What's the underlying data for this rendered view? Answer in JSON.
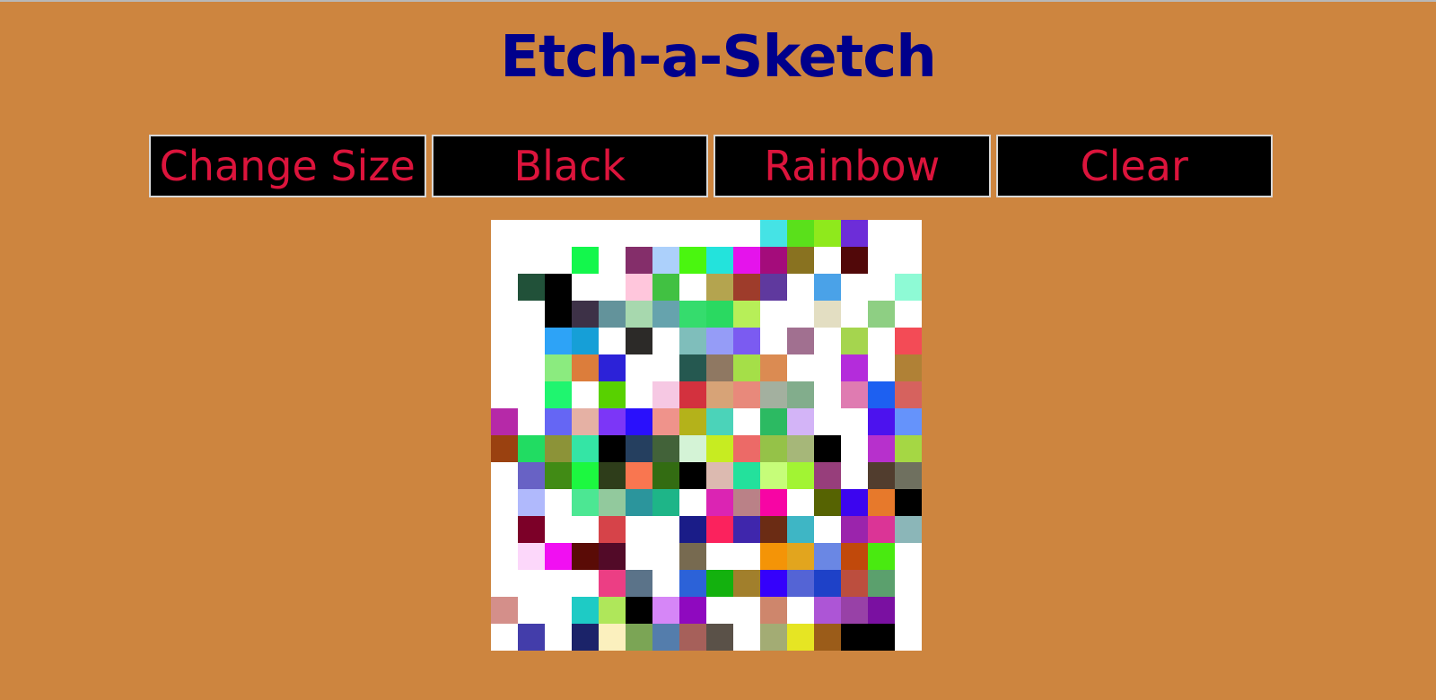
{
  "title": "Etch-a-Sketch",
  "buttons": [
    {
      "label": "Change Size"
    },
    {
      "label": "Black"
    },
    {
      "label": "Rainbow"
    },
    {
      "label": "Clear"
    }
  ],
  "colors": {
    "background": "#cd853f",
    "title": "#00008b",
    "button_text": "#dc143c",
    "button_bg": "#000000",
    "grid_empty": "#ffffff"
  },
  "grid": {
    "size": 16,
    "cells": [
      [
        "#ffffff",
        "#ffffff",
        "#ffffff",
        "#ffffff",
        "#ffffff",
        "#ffffff",
        "#ffffff",
        "#ffffff",
        "#ffffff",
        "#ffffff",
        "#45e3e5",
        "#5ae01b",
        "#8fe91c",
        "#6d2dd8",
        "#ffffff",
        "#ffffff"
      ],
      [
        "#ffffff",
        "#ffffff",
        "#ffffff",
        "#13f74c",
        "#ffffff",
        "#842e6a",
        "#acd0fb",
        "#4af60f",
        "#23e3dc",
        "#e513ec",
        "#a40c7b",
        "#897220",
        "#ffffff",
        "#510809",
        "#ffffff",
        "#ffffff"
      ],
      [
        "#ffffff",
        "#215139",
        "#000000",
        "#ffffff",
        "#ffffff",
        "#ffc6dc",
        "#41c142",
        "#ffffff",
        "#b4a44f",
        "#9e3c2b",
        "#5f399e",
        "#ffffff",
        "#4aa2e8",
        "#ffffff",
        "#ffffff",
        "#8efad5"
      ],
      [
        "#ffffff",
        "#ffffff",
        "#000000",
        "#3d3147",
        "#63939b",
        "#a7d8ae",
        "#66a3ad",
        "#35dc6d",
        "#2ad961",
        "#b7ef58",
        "#ffffff",
        "#ffffff",
        "#e3dec2",
        "#ffffff",
        "#8ecf83",
        "#ffffff"
      ],
      [
        "#ffffff",
        "#ffffff",
        "#2da3f7",
        "#169fd7",
        "#ffffff",
        "#2c2a28",
        "#ffffff",
        "#7fbebb",
        "#959cf7",
        "#7b5bf1",
        "#ffffff",
        "#a17090",
        "#ffffff",
        "#a5d54e",
        "#ffffff",
        "#f34b56"
      ],
      [
        "#ffffff",
        "#ffffff",
        "#8beb7f",
        "#dc7d3b",
        "#2c22d8",
        "#ffffff",
        "#ffffff",
        "#255850",
        "#8f7862",
        "#a5df48",
        "#db8b52",
        "#ffffff",
        "#ffffff",
        "#b42cdb",
        "#ffffff",
        "#b08136"
      ],
      [
        "#ffffff",
        "#ffffff",
        "#1ff56f",
        "#ffffff",
        "#58d100",
        "#ffffff",
        "#f6c8e3",
        "#d3313e",
        "#d7a377",
        "#e8897b",
        "#a3b09f",
        "#82ad8c",
        "#ffffff",
        "#df7bb1",
        "#1d60f1",
        "#d6625e"
      ],
      [
        "#b629a8",
        "#ffffff",
        "#6566f4",
        "#e5b1a4",
        "#7c36f7",
        "#2a10fc",
        "#ef938b",
        "#b4b21a",
        "#4bd3b9",
        "#ffffff",
        "#2cba62",
        "#d3b4f7",
        "#ffffff",
        "#ffffff",
        "#4c12ee",
        "#6593fb"
      ],
      [
        "#9a4110",
        "#21dc62",
        "#8c9338",
        "#34e5a5",
        "#000000",
        "#253f5f",
        "#426239",
        "#d4f3d6",
        "#c7ec21",
        "#ec6a67",
        "#95c248",
        "#a6b779",
        "#000000",
        "#ffffff",
        "#b730cc",
        "#a5d744"
      ],
      [
        "#ffffff",
        "#6862c5",
        "#418b15",
        "#1cf840",
        "#2e3d1a",
        "#f97650",
        "#336c12",
        "#000000",
        "#dcbab0",
        "#23e19c",
        "#c6fd79",
        "#a2f433",
        "#973e7b",
        "#ffffff",
        "#513d2e",
        "#6f705f"
      ],
      [
        "#ffffff",
        "#b0b9fc",
        "#ffffff",
        "#4ce793",
        "#92c99d",
        "#2b959c",
        "#1eb588",
        "#ffffff",
        "#db24b3",
        "#ba8187",
        "#f705a4",
        "#ffffff",
        "#566302",
        "#3c05ef",
        "#e7792b",
        "#000000"
      ],
      [
        "#ffffff",
        "#7c0028",
        "#ffffff",
        "#ffffff",
        "#d64349",
        "#ffffff",
        "#ffffff",
        "#1a1c88",
        "#fb225d",
        "#3f26ac",
        "#6b2c14",
        "#3eb6c5",
        "#ffffff",
        "#9b24ac",
        "#db3496",
        "#8bb6b8"
      ],
      [
        "#ffffff",
        "#fcd7fa",
        "#f10ff2",
        "#5a0b06",
        "#520a28",
        "#ffffff",
        "#ffffff",
        "#776a50",
        "#ffffff",
        "#ffffff",
        "#f49407",
        "#e2a51e",
        "#6a87e4",
        "#c1490b",
        "#49ea10",
        "#ffffff"
      ],
      [
        "#ffffff",
        "#ffffff",
        "#ffffff",
        "#ffffff",
        "#ec3e84",
        "#5b7389",
        "#ffffff",
        "#2c62d8",
        "#13b10e",
        "#a17f2c",
        "#3501fb",
        "#5464d5",
        "#1e41c8",
        "#bc4e3e",
        "#5ba06d",
        "#ffffff"
      ],
      [
        "#d48f8a",
        "#ffffff",
        "#ffffff",
        "#1ecbc5",
        "#afe75a",
        "#000000",
        "#d686f7",
        "#8f09bf",
        "#ffffff",
        "#ffffff",
        "#ce866c",
        "#ffffff",
        "#ad55d6",
        "#9841a7",
        "#7a10a1",
        "#ffffff"
      ],
      [
        "#ffffff",
        "#433daa",
        "#ffffff",
        "#1b2369",
        "#fbf0be",
        "#7ba555",
        "#547dac",
        "#a6605a",
        "#5a5148",
        "#ffffff",
        "#a3ac74",
        "#e6e523",
        "#9b5c19",
        "#000000",
        "#000000",
        "#ffffff"
      ]
    ]
  }
}
